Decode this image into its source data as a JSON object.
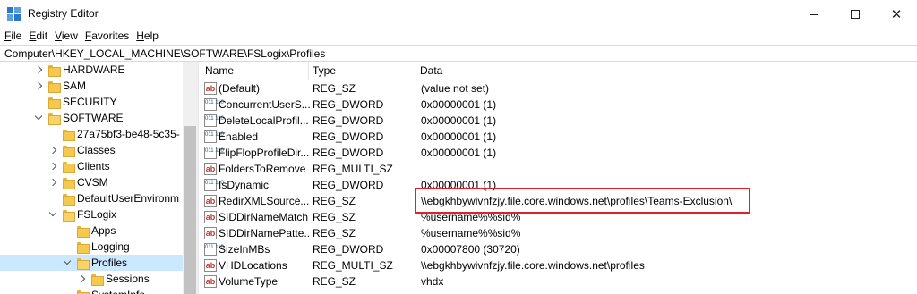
{
  "window": {
    "title": "Registry Editor"
  },
  "menu": [
    {
      "label": "File",
      "key": "F",
      "rest": "ile"
    },
    {
      "label": "Edit",
      "key": "E",
      "rest": "dit"
    },
    {
      "label": "View",
      "key": "V",
      "rest": "iew"
    },
    {
      "label": "Favorites",
      "key": "F",
      "rest": "avorites"
    },
    {
      "label": "Help",
      "key": "H",
      "rest": "elp"
    }
  ],
  "address": "Computer\\HKEY_LOCAL_MACHINE\\SOFTWARE\\FSLogix\\Profiles",
  "tree": [
    {
      "label": "HARDWARE",
      "expander": "right"
    },
    {
      "label": "SAM",
      "expander": "right"
    },
    {
      "label": "SECURITY",
      "expander": "none"
    },
    {
      "label": "SOFTWARE",
      "expander": "down"
    },
    {
      "label": "27a75bf3-be48-5c35-",
      "expander": "none"
    },
    {
      "label": "Classes",
      "expander": "right"
    },
    {
      "label": "Clients",
      "expander": "right"
    },
    {
      "label": "CVSM",
      "expander": "right"
    },
    {
      "label": "DefaultUserEnvironm",
      "expander": "none"
    },
    {
      "label": "FSLogix",
      "expander": "down"
    },
    {
      "label": "Apps",
      "expander": "none"
    },
    {
      "label": "Logging",
      "expander": "none"
    },
    {
      "label": "Profiles",
      "expander": "down",
      "selected": true
    },
    {
      "label": "Sessions",
      "expander": "right"
    },
    {
      "label": "SystemInfo",
      "expander": "none"
    }
  ],
  "columns": {
    "name": "Name",
    "type": "Type",
    "data": "Data"
  },
  "values": [
    {
      "icon": "string-value-icon",
      "name": "(Default)",
      "type": "REG_SZ",
      "data": "(value not set)"
    },
    {
      "icon": "binary-value-icon",
      "name": "ConcurrentUserS...",
      "type": "REG_DWORD",
      "data": "0x00000001 (1)"
    },
    {
      "icon": "binary-value-icon",
      "name": "DeleteLocalProfil...",
      "type": "REG_DWORD",
      "data": "0x00000001 (1)"
    },
    {
      "icon": "binary-value-icon",
      "name": "Enabled",
      "type": "REG_DWORD",
      "data": "0x00000001 (1)"
    },
    {
      "icon": "binary-value-icon",
      "name": "FlipFlopProfileDir...",
      "type": "REG_DWORD",
      "data": "0x00000001 (1)"
    },
    {
      "icon": "string-value-icon",
      "name": "FoldersToRemove",
      "type": "REG_MULTI_SZ",
      "data": ""
    },
    {
      "icon": "binary-value-icon",
      "name": "IsDynamic",
      "type": "REG_DWORD",
      "data": "0x00000001 (1)"
    },
    {
      "icon": "string-value-icon",
      "name": "RedirXMLSource...",
      "type": "REG_SZ",
      "data": "\\\\ebgkhbywivnfzjy.file.core.windows.net\\profiles\\Teams-Exclusion\\",
      "focused": true
    },
    {
      "icon": "string-value-icon",
      "name": "SIDDirNameMatch",
      "type": "REG_SZ",
      "data": "%username%%sid%"
    },
    {
      "icon": "string-value-icon",
      "name": "SIDDirNamePatte...",
      "type": "REG_SZ",
      "data": "%username%%sid%"
    },
    {
      "icon": "binary-value-icon",
      "name": "SizeInMBs",
      "type": "REG_DWORD",
      "data": "0x00007800 (30720)"
    },
    {
      "icon": "string-value-icon",
      "name": "VHDLocations",
      "type": "REG_MULTI_SZ",
      "data": "\\\\ebgkhbywivnfzjy.file.core.windows.net\\profiles"
    },
    {
      "icon": "string-value-icon",
      "name": "VolumeType",
      "type": "REG_SZ",
      "data": "vhdx"
    }
  ],
  "icon_glyphs": {
    "string": "ab",
    "binary": "011 110"
  },
  "colors": {
    "selection": "#cce8ff",
    "highlight_box": "#e0202a",
    "folder": "#f5c94e"
  }
}
